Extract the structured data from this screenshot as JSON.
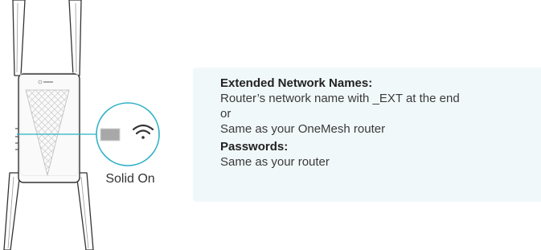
{
  "device": {
    "brand_logo": "tp-link",
    "led_indicator": "wifi-icon",
    "status_text": "Solid On"
  },
  "info": {
    "extended_heading": "Extended Network Names:",
    "extended_line1": "Router’s network name with _EXT at the end",
    "or_text": "or",
    "extended_line2": "Same as your OneMesh router",
    "passwords_heading": "Passwords:",
    "passwords_line": "Same as your router"
  },
  "colors": {
    "accent": "#2bb1c4",
    "panel_bg": "#f1f8f9",
    "outline": "#333333"
  }
}
